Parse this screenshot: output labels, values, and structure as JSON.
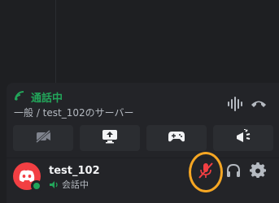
{
  "voice": {
    "status": "通話中",
    "channel": "一般 / test_102のサーバー"
  },
  "user": {
    "name": "test_102",
    "substatus": "会話中"
  },
  "icons": {
    "signal": "signal-icon",
    "sound_wave": "noise-suppression-icon",
    "disconnect": "disconnect-icon",
    "camera_off": "camera-off-icon",
    "screen_share": "screen-share-icon",
    "activity": "activity-gamepad-icon",
    "soundboard": "soundboard-icon",
    "mic_muted": "mic-muted-icon",
    "headset": "headset-icon",
    "settings": "gear-icon"
  },
  "colors": {
    "connected": "#23a55a",
    "muted": "#f23f43",
    "highlight": "#f5a623",
    "avatar": "#f23f43"
  }
}
